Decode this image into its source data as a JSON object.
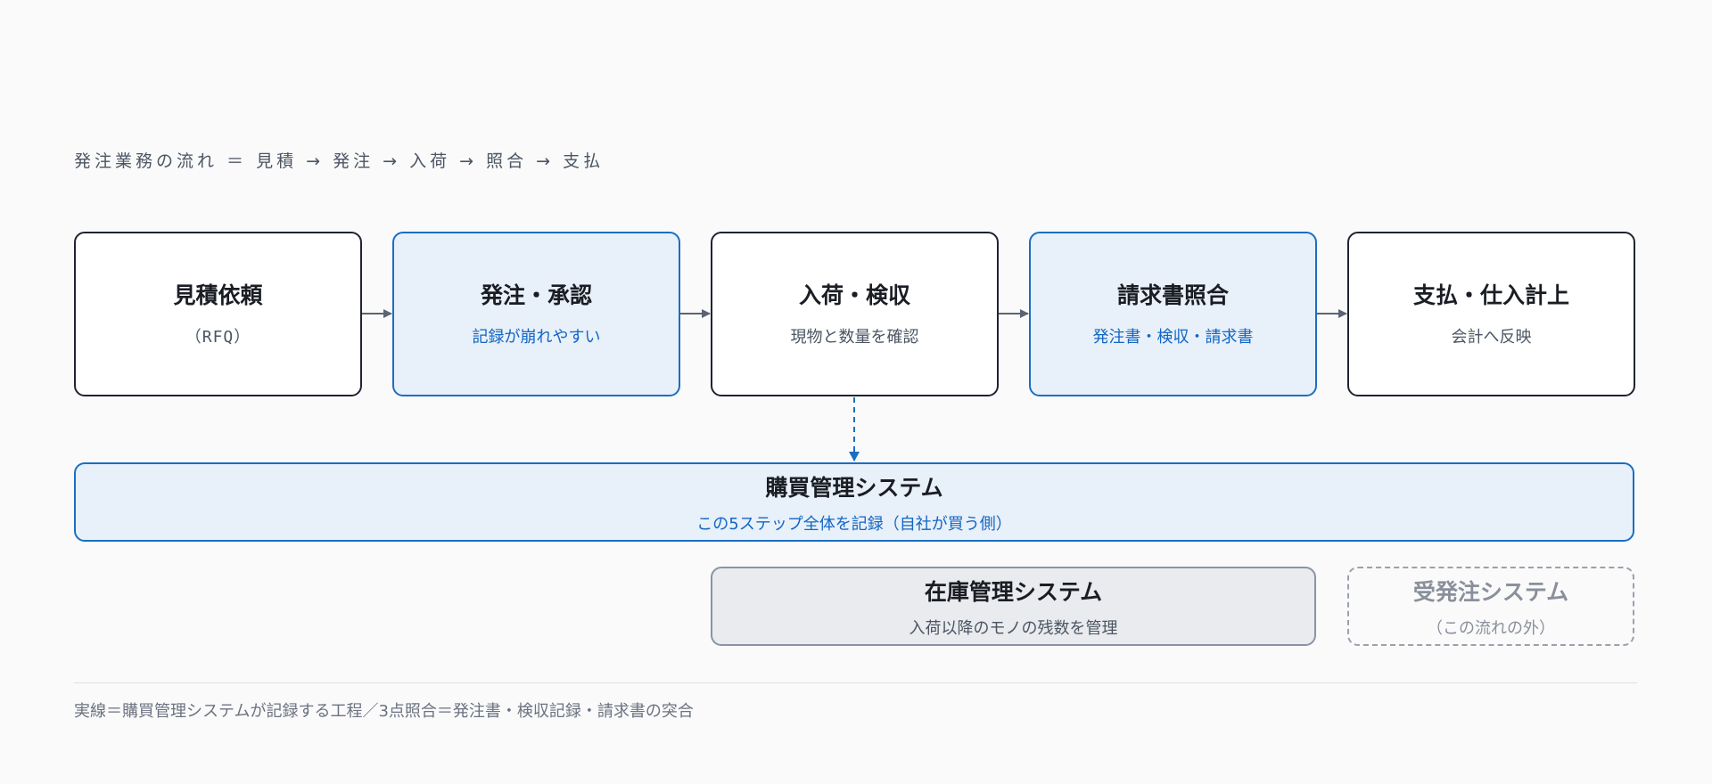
{
  "flow_caption": "発注業務の流れ ＝ 見積 → 発注 → 入荷 → 照合 → 支払",
  "steps": [
    {
      "title": "見積依頼",
      "sub": "（RFQ）"
    },
    {
      "title": "発注・承認",
      "sub": "記録が崩れやすい"
    },
    {
      "title": "入荷・検収",
      "sub": "現物と数量を確認"
    },
    {
      "title": "請求書照合",
      "sub": "発注書・検収・請求書"
    },
    {
      "title": "支払・仕入計上",
      "sub": "会計へ反映"
    }
  ],
  "systems": {
    "purchase": {
      "title": "購買管理システム",
      "sub": "この5ステップ全体を記録（自社が買う側）"
    },
    "inventory": {
      "title": "在庫管理システム",
      "sub": "入荷以降のモノの残数を管理"
    },
    "order": {
      "title": "受発注システム",
      "sub": "（この流れの外）"
    }
  },
  "legend": "実線＝購買管理システムが記録する工程／3点照合＝発注書・検収記録・請求書の突合",
  "colors": {
    "accent": "#1b6ec2",
    "accent_fill": "#e8f0f9",
    "neutral_border": "#1f2430",
    "arrow": "#5b6473"
  }
}
